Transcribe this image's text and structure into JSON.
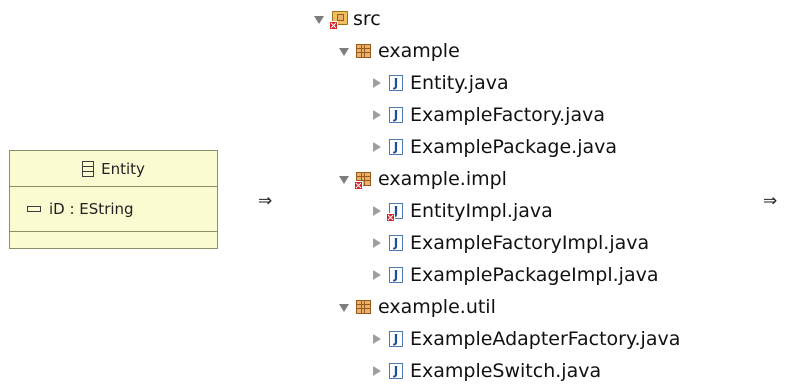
{
  "uml_class": {
    "name": "Entity",
    "attribute": "iD : EString"
  },
  "arrows": {
    "left": "⇒",
    "right": "⇒"
  },
  "tree": {
    "root": {
      "label": "src",
      "expanded": true,
      "has_error": true
    },
    "packages": [
      {
        "label": "example",
        "expanded": true,
        "has_error": false,
        "files": [
          {
            "label": "Entity.java",
            "has_error": false
          },
          {
            "label": "ExampleFactory.java",
            "has_error": false
          },
          {
            "label": "ExamplePackage.java",
            "has_error": false
          }
        ]
      },
      {
        "label": "example.impl",
        "expanded": true,
        "has_error": true,
        "files": [
          {
            "label": "EntityImpl.java",
            "has_error": true
          },
          {
            "label": "ExampleFactoryImpl.java",
            "has_error": false
          },
          {
            "label": "ExamplePackageImpl.java",
            "has_error": false
          }
        ]
      },
      {
        "label": "example.util",
        "expanded": true,
        "has_error": false,
        "files": [
          {
            "label": "ExampleAdapterFactory.java",
            "has_error": false
          },
          {
            "label": "ExampleSwitch.java",
            "has_error": false
          }
        ]
      }
    ]
  },
  "colors": {
    "uml_fill": "#fbfbd2",
    "uml_border": "#8a8f6a",
    "package_icon": "#e7b16c",
    "java_icon": "#1f4f99",
    "error_badge": "#d42020"
  }
}
